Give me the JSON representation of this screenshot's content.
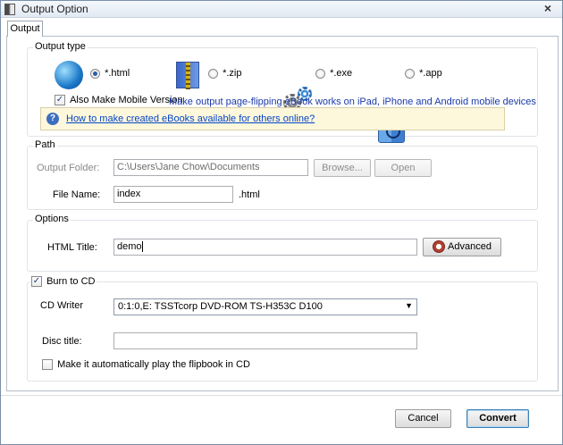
{
  "window": {
    "title": "Output Option",
    "close_glyph": "×"
  },
  "tabs": [
    {
      "label": "Output",
      "active": true
    }
  ],
  "output_type": {
    "legend": "Output type",
    "options": [
      {
        "label": "*.html",
        "icon": "html-globe-icon",
        "selected": true
      },
      {
        "label": "*.zip",
        "icon": "zip-archive-icon",
        "selected": false
      },
      {
        "label": "*.exe",
        "icon": "exe-gears-icon",
        "selected": false
      },
      {
        "label": "*.app",
        "icon": "mac-finder-icon",
        "selected": false
      }
    ],
    "mobile_checkbox_label": "Also Make Mobile Version",
    "mobile_checked": true,
    "mobile_description": "Make output page-flipping eBook works on iPad, iPhone and Android mobile devices",
    "info_link": "How to make created eBooks available for others online?"
  },
  "path": {
    "legend": "Path",
    "output_folder_label": "Output Folder:",
    "output_folder_value": "C:\\Users\\Jane Chow\\Documents",
    "browse_label": "Browse...",
    "open_label": "Open",
    "file_name_label": "File Name:",
    "file_name_value": "index",
    "file_ext": ".html"
  },
  "options": {
    "legend": "Options",
    "html_title_label": "HTML Title:",
    "html_title_value": "demo",
    "advanced_label": "Advanced"
  },
  "burn": {
    "checkbox_label": "Burn to CD",
    "checked": true,
    "cd_writer_label": "CD Writer",
    "cd_writer_value": "0:1:0,E: TSSTcorp DVD-ROM TS-H353C D100",
    "disc_title_label": "Disc title:",
    "disc_title_value": "",
    "autoplay_label": "Make it automatically play the flipbook in CD",
    "autoplay_checked": false
  },
  "footer": {
    "cancel_label": "Cancel",
    "convert_label": "Convert"
  },
  "colors": {
    "link": "#0645c8",
    "info_bg": "#fdf8dc",
    "description": "#1a3aa8"
  }
}
